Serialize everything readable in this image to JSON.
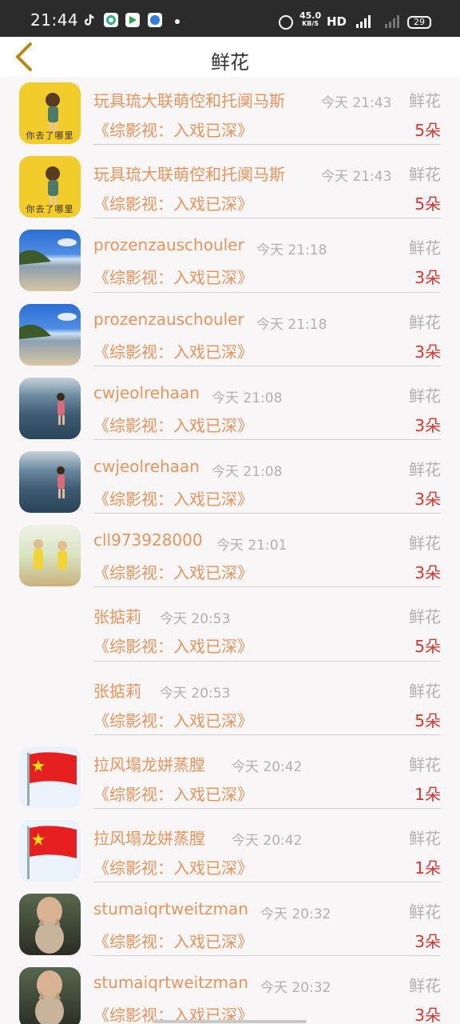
{
  "status_bar": {
    "time": "21:44",
    "speed_value": "45.0",
    "speed_unit": "KB/S",
    "hd_label": "HD",
    "network_label": "4G",
    "battery": "29"
  },
  "header": {
    "title": "鲜花",
    "back_icon": "chevron-left-icon"
  },
  "records": [
    {
      "name": "玩具琉大联萌倥和托阒马斯",
      "time": "今天 21:43",
      "gift": "鲜花",
      "book": "《综影视：入戏已深》",
      "count": "5朵",
      "avatar": "yellow",
      "avatar_text": "你去了哪里"
    },
    {
      "name": "玩具琉大联萌倥和托阒马斯",
      "time": "今天 21:43",
      "gift": "鲜花",
      "book": "《综影视：入戏已深》",
      "count": "5朵",
      "avatar": "yellow",
      "avatar_text": "你去了哪里"
    },
    {
      "name": "prozenzauschouler",
      "time": "今天 21:18",
      "gift": "鲜花",
      "book": "《综影视：入戏已深》",
      "count": "3朵",
      "avatar": "beach"
    },
    {
      "name": "prozenzauschouler",
      "time": "今天 21:18",
      "gift": "鲜花",
      "book": "《综影视：入戏已深》",
      "count": "3朵",
      "avatar": "beach"
    },
    {
      "name": "cwjeolrehaan",
      "time": "今天 21:08",
      "gift": "鲜花",
      "book": "《综影视：入戏已深》",
      "count": "3朵",
      "avatar": "sea"
    },
    {
      "name": "cwjeolrehaan",
      "time": "今天 21:08",
      "gift": "鲜花",
      "book": "《综影视：入戏已深》",
      "count": "3朵",
      "avatar": "sea"
    },
    {
      "name": "cll973928000",
      "time": "今天 21:01",
      "gift": "鲜花",
      "book": "《综影视：入戏已深》",
      "count": "3朵",
      "avatar": "kids"
    },
    {
      "name": "张掂莉",
      "time": "今天 20:53",
      "gift": "鲜花",
      "book": "《综影视：入戏已深》",
      "count": "5朵",
      "avatar": "blank"
    },
    {
      "name": "张掂莉",
      "time": "今天 20:53",
      "gift": "鲜花",
      "book": "《综影视：入戏已深》",
      "count": "5朵",
      "avatar": "blank"
    },
    {
      "name": "拉风塌龙姘蒸膛",
      "time": "今天 20:42",
      "gift": "鲜花",
      "book": "《综影视：入戏已深》",
      "count": "1朵",
      "avatar": "flag"
    },
    {
      "name": "拉风塌龙姘蒸膛",
      "time": "今天 20:42",
      "gift": "鲜花",
      "book": "《综影视：入戏已深》",
      "count": "1朵",
      "avatar": "flag"
    },
    {
      "name": "stumaiqrtweitzman",
      "time": "今天 20:32",
      "gift": "鲜花",
      "book": "《综影视：入戏已深》",
      "count": "3朵",
      "avatar": "cat"
    },
    {
      "name": "stumaiqrtweitzman",
      "time": "今天 20:32",
      "gift": "鲜花",
      "book": "《综影视：入戏已深》",
      "count": "3朵",
      "avatar": "cat"
    }
  ],
  "colors": {
    "name": "#e8945c",
    "count": "#d6362e",
    "muted": "#b0b0b0",
    "header_bg": "#ffffff",
    "status_bg": "#2b2b2b"
  }
}
